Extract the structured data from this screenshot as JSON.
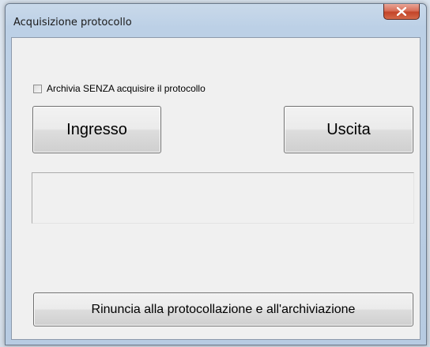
{
  "window": {
    "title": "Acquisizione protocollo",
    "close_icon": "close-icon"
  },
  "form": {
    "checkbox_label": "Archivia SENZA acquisire il protocollo",
    "checkbox_checked": false,
    "ingresso_label": "Ingresso",
    "uscita_label": "Uscita",
    "status_text": "",
    "rinuncia_label": "Rinuncia alla protocollazione e all'archiviazione"
  },
  "colors": {
    "close_button": "#c34429",
    "client_background": "#f0f0f0"
  }
}
